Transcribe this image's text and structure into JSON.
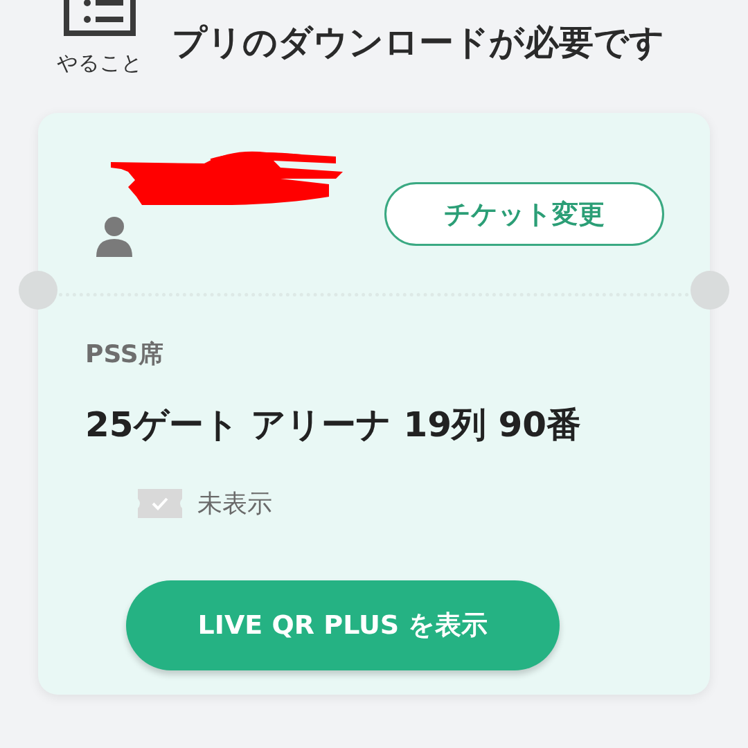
{
  "task": {
    "label": "やること",
    "text": "プリのダウンロードが必要です"
  },
  "ticket": {
    "change_button": "チケット変更",
    "seat_type": "PSS席",
    "seat": "25ゲート アリーナ 19列 90番",
    "display_status": {
      "label": "未表示",
      "displayed": false
    },
    "show_button": "LIVE QR PLUS を表示"
  }
}
